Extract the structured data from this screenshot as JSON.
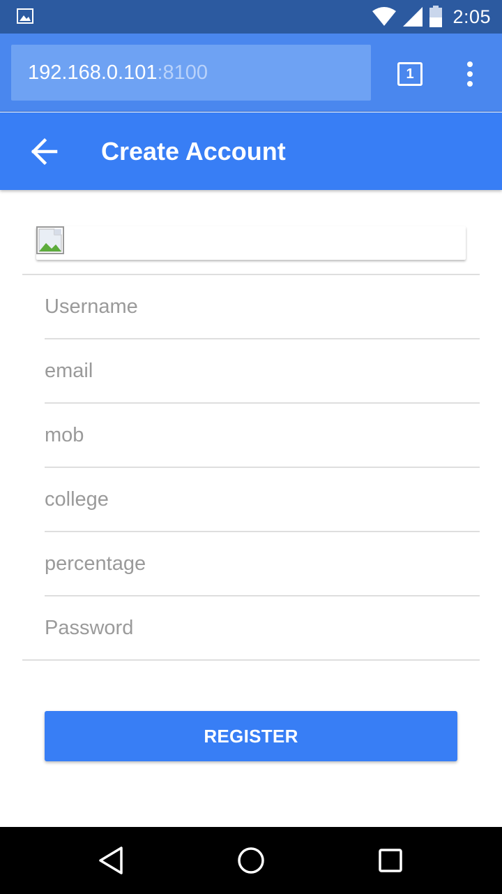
{
  "status_bar": {
    "time": "2:05",
    "icons": [
      "gallery-notification-icon",
      "wifi-icon",
      "signal-icon",
      "battery-icon"
    ]
  },
  "browser": {
    "url_host": "192.168.0.101",
    "url_port": ":8100",
    "tab_count": "1"
  },
  "header": {
    "title": "Create Account"
  },
  "form": {
    "fields": [
      {
        "placeholder": "Username"
      },
      {
        "placeholder": "email"
      },
      {
        "placeholder": "mob"
      },
      {
        "placeholder": "college"
      },
      {
        "placeholder": "percentage"
      },
      {
        "placeholder": "Password"
      }
    ],
    "register_label": "REGISTER"
  },
  "colors": {
    "status_bar": "#2c5aa0",
    "browser_toolbar": "#4a87ee",
    "primary": "#387ef5"
  }
}
